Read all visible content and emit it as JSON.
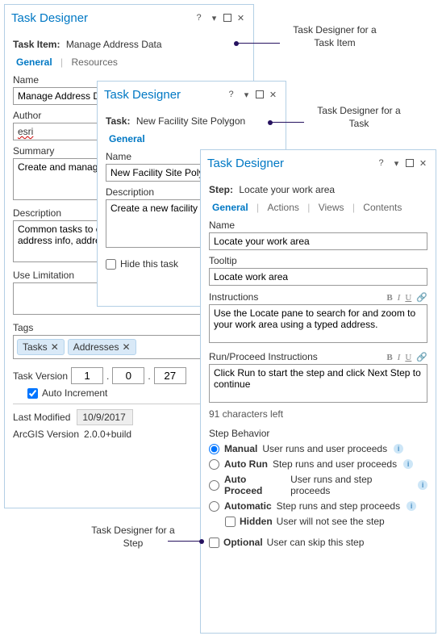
{
  "annotations": {
    "taskItem": "Task Designer for a\nTask Item",
    "task": "Task Designer for a\nTask",
    "step": "Task Designer for a\nStep"
  },
  "pane1": {
    "title": "Task Designer",
    "headingLabel": "Task Item:",
    "headingValue": "Manage Address Data",
    "tabs": {
      "general": "General",
      "resources": "Resources"
    },
    "name": {
      "label": "Name",
      "value": "Manage Address Data"
    },
    "author": {
      "label": "Author",
      "value": "esri"
    },
    "summary": {
      "label": "Summary",
      "value": "Create and manage addresses and roads."
    },
    "description": {
      "label": "Description",
      "value": "Common tasks to create road centerlines with address info, addresses, and related annotation."
    },
    "useLimitation": {
      "label": "Use Limitation",
      "value": ""
    },
    "tags": {
      "label": "Tags",
      "items": [
        "Tasks",
        "Addresses"
      ]
    },
    "version": {
      "label": "Task Version",
      "major": "1",
      "minor": "0",
      "patch": "27",
      "autoInc": "Auto Increment"
    },
    "lastModified": {
      "label": "Last Modified",
      "value": "10/9/2017"
    },
    "arcgisVersion": {
      "label": "ArcGIS Version",
      "value": "2.0.0+build"
    }
  },
  "pane2": {
    "title": "Task Designer",
    "headingLabel": "Task:",
    "headingValue": "New Facility Site Polygon",
    "tabs": {
      "general": "General"
    },
    "name": {
      "label": "Name",
      "value": "New Facility Site Polygon"
    },
    "description": {
      "label": "Description",
      "value": "Create a new facility site polygon."
    },
    "hideTask": "Hide this task"
  },
  "pane3": {
    "title": "Task Designer",
    "headingLabel": "Step:",
    "headingValue": "Locate your work area",
    "tabs": {
      "general": "General",
      "actions": "Actions",
      "views": "Views",
      "contents": "Contents"
    },
    "name": {
      "label": "Name",
      "value": "Locate your work area"
    },
    "tooltip": {
      "label": "Tooltip",
      "value": "Locate work area"
    },
    "instructions": {
      "label": "Instructions",
      "value": "Use the Locate pane to search for and zoom to your work area using a typed address."
    },
    "runProceed": {
      "label": "Run/Proceed Instructions",
      "value": "Click Run to start the step and click Next Step to continue"
    },
    "charsLeft": "91 characters left",
    "behaviorLabel": "Step Behavior",
    "behaviors": {
      "manual": {
        "label": "Manual",
        "desc": "User runs and user proceeds"
      },
      "autoRun": {
        "label": "Auto Run",
        "desc": "Step runs and user proceeds"
      },
      "autoProceed": {
        "label": "Auto Proceed",
        "desc": "User runs and step proceeds"
      },
      "automatic": {
        "label": "Automatic",
        "desc": "Step runs and step proceeds"
      }
    },
    "hidden": {
      "label": "Hidden",
      "desc": "User will not see the step"
    },
    "optional": {
      "label": "Optional",
      "desc": "User can skip this step"
    }
  }
}
